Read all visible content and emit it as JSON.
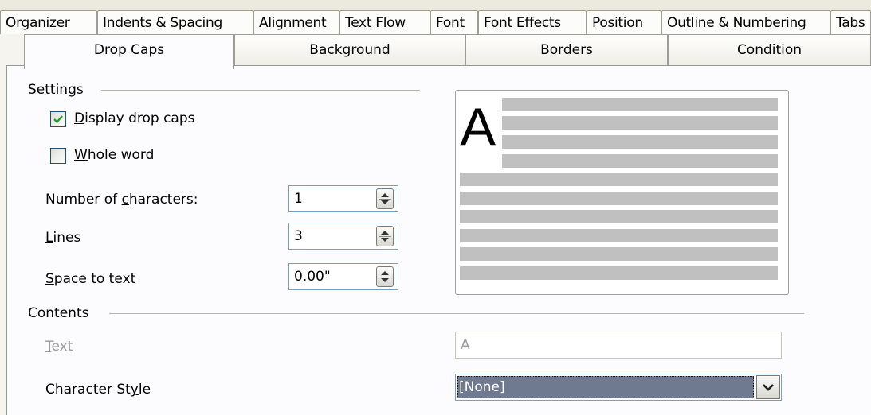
{
  "top_tabs": [
    "Organizer",
    "Indents & Spacing",
    "Alignment",
    "Text Flow",
    "Font",
    "Font Effects",
    "Position",
    "Outline & Numbering",
    "Tabs"
  ],
  "sub_tabs": [
    "Drop Caps",
    "Background",
    "Borders",
    "Condition"
  ],
  "settings": {
    "section_label": "Settings",
    "display_drop_caps": {
      "label_u": "D",
      "label_rest": "isplay drop caps",
      "checked": true
    },
    "whole_word": {
      "label_u": "W",
      "label_rest": "hole word",
      "checked": false
    },
    "num_chars": {
      "label_pre": "Number of ",
      "label_u": "c",
      "label_rest": "haracters:",
      "value": "1"
    },
    "lines": {
      "label_u": "L",
      "label_rest": "ines",
      "value": "3"
    },
    "space_to_text": {
      "label_u": "S",
      "label_rest": "pace to text",
      "value": "0.00\""
    }
  },
  "preview": {
    "drop_letter": "A"
  },
  "contents": {
    "section_label": "Contents",
    "text": {
      "label_u": "T",
      "label_rest": "ext",
      "value": "A"
    },
    "char_style": {
      "label_pre": "Character St",
      "label_u": "y",
      "label_rest": "le",
      "value": "[None]"
    }
  }
}
